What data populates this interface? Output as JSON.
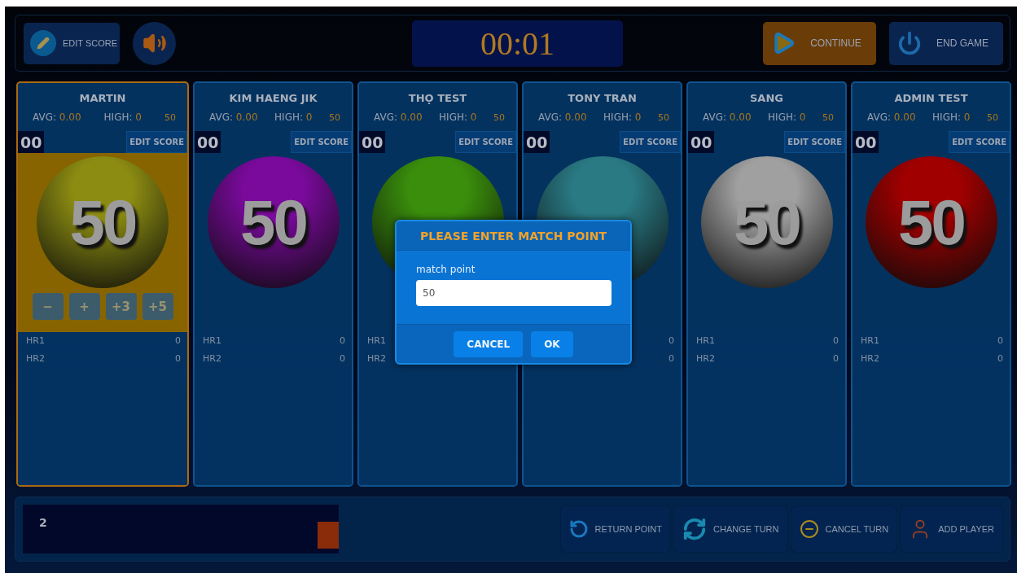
{
  "top_bar": {
    "edit_score": "EDIT SCORE",
    "timer": "00:01",
    "buttons": [
      {
        "label": "CONTINUE",
        "kind": "continue"
      },
      {
        "label": "END GAME",
        "kind": "end"
      }
    ]
  },
  "players": [
    {
      "name": "MARTIN",
      "avg_label": "AVG:",
      "avg": "0.00",
      "high_label": "HIGH:",
      "high": "0",
      "target": "50",
      "score": "00",
      "edit_label": "EDIT SCORE",
      "ball": "50",
      "color": "#8c8c12",
      "selected": true,
      "controls": [
        "−",
        "+",
        "+3",
        "+5"
      ],
      "rows": [
        {
          "label": "HR1",
          "value": "0"
        },
        {
          "label": "HR2",
          "value": "0"
        }
      ]
    },
    {
      "name": "KIM HAENG JIK",
      "avg_label": "AVG:",
      "avg": "0.00",
      "high_label": "HIGH:",
      "high": "0",
      "target": "50",
      "score": "00",
      "edit_label": "EDIT SCORE",
      "ball": "50",
      "color": "#7a0a9c",
      "selected": false,
      "rows": [
        {
          "label": "HR1",
          "value": "0"
        },
        {
          "label": "HR2",
          "value": "0"
        }
      ]
    },
    {
      "name": "THỌ TEST",
      "avg_label": "AVG:",
      "avg": "0.00",
      "high_label": "HIGH:",
      "high": "0",
      "target": "50",
      "score": "00",
      "edit_label": "EDIT SCORE",
      "color": "#3a8e0c",
      "selected": false,
      "rows": [
        {
          "label": "HR1"
        },
        {
          "label": "HR2"
        }
      ]
    },
    {
      "name": "TONY TRAN",
      "avg_label": "AVG:",
      "avg": "0.00",
      "high_label": "HIGH:",
      "high": "0",
      "target": "50",
      "score": "00",
      "edit_label": "EDIT SCORE",
      "color": "#2a7a84",
      "selected": false,
      "rows": [
        {
          "value": "0"
        },
        {
          "value": "0"
        }
      ]
    },
    {
      "name": "SANG",
      "avg_label": "AVG:",
      "avg": "0.00",
      "high_label": "HIGH:",
      "high": "0",
      "target": "50",
      "score": "00",
      "edit_label": "EDIT SCORE",
      "ball": "50",
      "color": "#a0a0a0",
      "selected": false,
      "rows": [
        {
          "label": "HR1",
          "value": "0"
        },
        {
          "label": "HR2",
          "value": "0"
        }
      ]
    },
    {
      "name": "ADMIN TEST",
      "avg_label": "AVG:",
      "avg": "0.00",
      "high_label": "HIGH:",
      "high": "0",
      "target": "50",
      "score": "00",
      "edit_label": "EDIT SCORE",
      "ball": "50",
      "color": "#a00000",
      "selected": false,
      "rows": [
        {
          "label": "HR1",
          "value": "0"
        },
        {
          "label": "HR2",
          "value": "0"
        }
      ]
    }
  ],
  "bottom_bar": {
    "turn": "2",
    "buttons": [
      {
        "label": "RETURN POINT",
        "kind": "return"
      },
      {
        "label": "CHANGE TURN",
        "kind": "change"
      },
      {
        "label": "CANCEL TURN",
        "kind": "cancel"
      },
      {
        "label": "ADD PLAYER",
        "kind": "add"
      }
    ]
  },
  "dialog": {
    "title": "PLEASE ENTER MATCH POINT",
    "field_label": "match point",
    "value": "50",
    "buttons": [
      {
        "label": "CANCEL"
      },
      {
        "label": "OK"
      }
    ]
  }
}
